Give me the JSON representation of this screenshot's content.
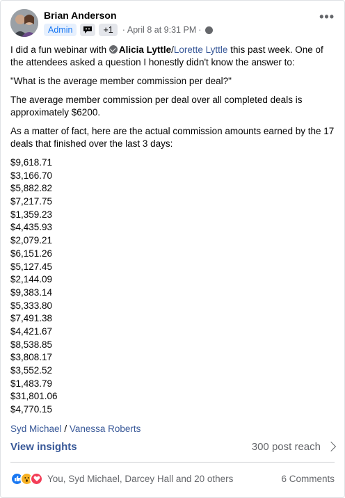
{
  "post": {
    "author": "Brian Anderson",
    "role_badge": "Admin",
    "extra_badges": "+1",
    "timestamp": "April 8 at 9:31 PM",
    "intro_pre": "I did a fun webinar with ",
    "mention_1": "Alicia Lyttle",
    "mention_sep": "/",
    "mention_2": "Lorette Lyttle",
    "intro_post": " this past week.  One of the attendees asked a question I honestly didn't know the answer to:",
    "question": "\"What is the average member commission per deal?\"",
    "answer": "The average member commission per deal over all completed deals is approximately $6200.",
    "followup": "As a matter of fact, here are the actual commission amounts earned by the 17 deals that finished over the last 3 days:",
    "amounts": [
      "$9,618.71",
      "$3,166.70",
      "$5,882.82",
      "$7,217.75",
      "$1,359.23",
      "$4,435.93",
      "$2,079.21",
      "$6,151.26",
      "$5,127.45",
      "$2,144.09",
      "$9,383.14",
      "$5,333.80",
      "$7,491.38",
      "$4,421.67",
      "$8,538.85",
      "$3,808.17",
      "$3,552.52",
      "$1,483.79",
      "$31,801.06",
      "$4,770.15"
    ],
    "tag_1": "Syd Michael",
    "tag_sep": "/",
    "tag_2": "Vanessa Roberts"
  },
  "insights": {
    "link_label": "View insights",
    "reach": "300 post reach"
  },
  "reactions": {
    "names": "You, Syd Michael, Darcey Hall and 20 others",
    "comments": "6 Comments"
  },
  "colors": {
    "link": "#385898",
    "accent": "#1877f2",
    "muted": "#65676b"
  }
}
